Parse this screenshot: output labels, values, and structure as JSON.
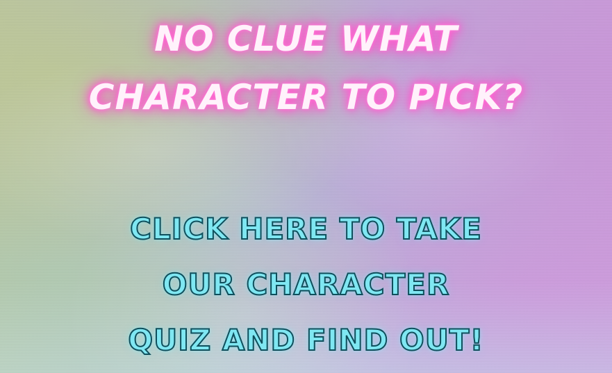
{
  "banner": {
    "headline": {
      "line1": "NO CLUE WHAT",
      "line2": "CHARACTER TO PICK?"
    },
    "cta": {
      "line1": "CLICK HERE TO TAKE",
      "line2": "OUR CHARACTER",
      "line3": "QUIZ AND FIND OUT!"
    },
    "colors": {
      "headline_glow": "#ff5fcf",
      "cta_fill": "#7fe7f2",
      "cta_outline": "#0f4f5c"
    }
  }
}
